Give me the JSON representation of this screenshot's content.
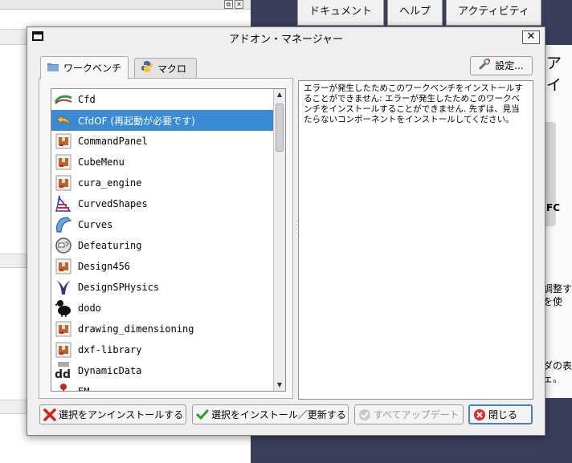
{
  "dialog": {
    "title": "アドオン・マネージャー",
    "close_glyph": "✕",
    "settings_label": "設定...",
    "tabs": [
      {
        "label": "ワークベンチ",
        "icon": "folder-icon",
        "active": true
      },
      {
        "label": "マクロ",
        "icon": "python-icon",
        "active": false
      }
    ],
    "workbenches": [
      {
        "label": "Cfd",
        "icon": "cfd-icon"
      },
      {
        "label": "CfdOF (再起動が必要です)",
        "icon": "undo-arrow-icon",
        "selected": true
      },
      {
        "label": "CommandPanel",
        "icon": "package-icon"
      },
      {
        "label": "CubeMenu",
        "icon": "package-icon"
      },
      {
        "label": "cura_engine",
        "icon": "package-icon"
      },
      {
        "label": "CurvedShapes",
        "icon": "curved-shapes-icon"
      },
      {
        "label": "Curves",
        "icon": "curves-icon"
      },
      {
        "label": "Defeaturing",
        "icon": "defeaturing-icon"
      },
      {
        "label": "Design456",
        "icon": "package-icon"
      },
      {
        "label": "DesignSPHysics",
        "icon": "sph-icon"
      },
      {
        "label": "dodo",
        "icon": "dodo-icon"
      },
      {
        "label": "drawing_dimensioning",
        "icon": "package-icon"
      },
      {
        "label": "dxf-library",
        "icon": "package-icon"
      },
      {
        "label": "DynamicData",
        "icon": "dynamicdata-icon"
      },
      {
        "label": "EM",
        "icon": "em-icon"
      }
    ],
    "description": "エラーが発生したためこのワークベンチをインストールすることができません: エラーが発生したためこのワークベンチをインストールすることができません. 先ずは、見当たらないコンポーネントをインストールしてください。",
    "buttons": {
      "uninstall": "選択をアンインストールする",
      "install": "選択をインストール／更新する",
      "update_all": "すべてアップデート",
      "close": "閉じる"
    }
  },
  "background": {
    "tabs": [
      "ドキュメント",
      "ヘルプ",
      "アクティビティ"
    ],
    "panel_texts": [
      "ア イ",
      "FC",
      "調整す\nを使",
      "ダの表\nェ。"
    ]
  },
  "colors": {
    "selection": "#3a8bd4",
    "background_dark": "#3a3f5c",
    "dialog_bg": "#efefef"
  }
}
